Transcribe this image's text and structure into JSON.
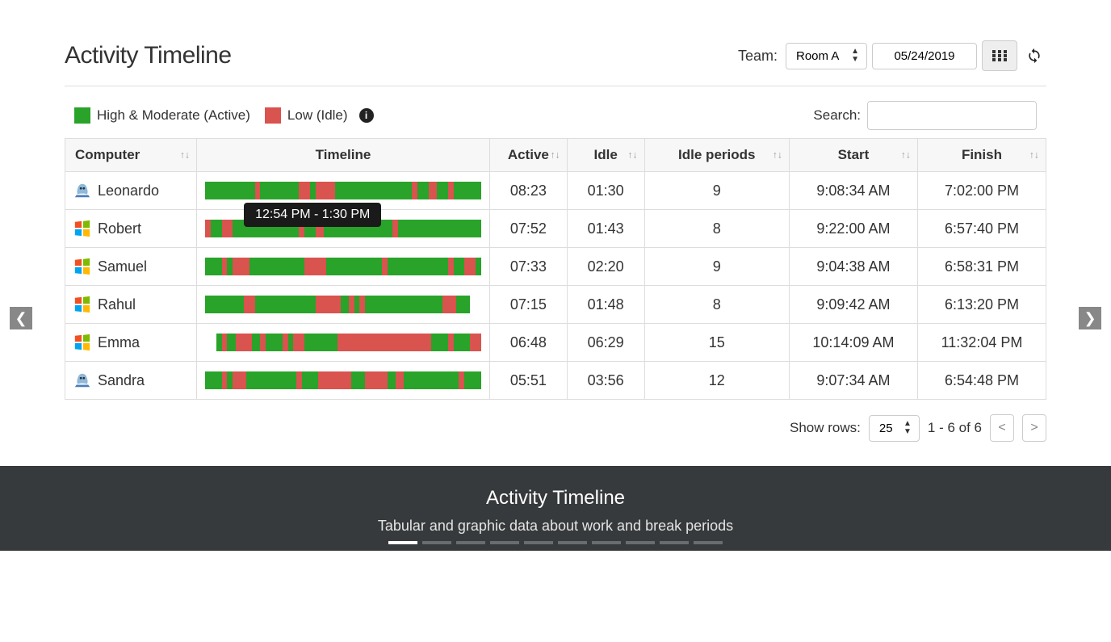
{
  "header": {
    "title": "Activity Timeline",
    "team_label": "Team:",
    "team_value": "Room A",
    "date_value": "05/24/2019"
  },
  "legend": {
    "active_label": "High & Moderate (Active)",
    "idle_label": "Low (Idle)"
  },
  "search": {
    "label": "Search:",
    "value": ""
  },
  "columns": {
    "computer": "Computer",
    "timeline": "Timeline",
    "active": "Active",
    "idle": "Idle",
    "idle_periods": "Idle periods",
    "start": "Start",
    "finish": "Finish"
  },
  "tooltip": "12:54 PM - 1:30 PM",
  "rows": [
    {
      "name": "Leonardo",
      "os": "mac",
      "active": "08:23",
      "idle": "01:30",
      "periods": "9",
      "start": "9:08:34 AM",
      "finish": "7:02:00 PM",
      "segments": [
        [
          "g",
          18
        ],
        [
          "r",
          2
        ],
        [
          "g",
          14
        ],
        [
          "r",
          4
        ],
        [
          "g",
          2
        ],
        [
          "r",
          7
        ],
        [
          "g",
          28
        ],
        [
          "r",
          2
        ],
        [
          "g",
          4
        ],
        [
          "r",
          3
        ],
        [
          "g",
          4
        ],
        [
          "r",
          2
        ],
        [
          "g",
          10
        ]
      ]
    },
    {
      "name": "Robert",
      "os": "win",
      "active": "07:52",
      "idle": "01:43",
      "periods": "8",
      "start": "9:22:00 AM",
      "finish": "6:57:40 PM",
      "segments": [
        [
          "r",
          2
        ],
        [
          "g",
          4
        ],
        [
          "r",
          4
        ],
        [
          "g",
          24
        ],
        [
          "r",
          2
        ],
        [
          "g",
          4
        ],
        [
          "r",
          3
        ],
        [
          "g",
          25
        ],
        [
          "r",
          2
        ],
        [
          "g",
          30
        ]
      ]
    },
    {
      "name": "Samuel",
      "os": "win",
      "active": "07:33",
      "idle": "02:20",
      "periods": "9",
      "start": "9:04:38 AM",
      "finish": "6:58:31 PM",
      "segments": [
        [
          "g",
          6
        ],
        [
          "r",
          2
        ],
        [
          "g",
          2
        ],
        [
          "r",
          6
        ],
        [
          "g",
          20
        ],
        [
          "r",
          8
        ],
        [
          "g",
          20
        ],
        [
          "r",
          2
        ],
        [
          "g",
          22
        ],
        [
          "r",
          2
        ],
        [
          "g",
          4
        ],
        [
          "r",
          4
        ],
        [
          "g",
          2
        ]
      ]
    },
    {
      "name": "Rahul",
      "os": "win",
      "active": "07:15",
      "idle": "01:48",
      "periods": "8",
      "start": "9:09:42 AM",
      "finish": "6:13:20 PM",
      "segments": [
        [
          "g",
          14
        ],
        [
          "r",
          4
        ],
        [
          "g",
          22
        ],
        [
          "r",
          9
        ],
        [
          "g",
          3
        ],
        [
          "r",
          2
        ],
        [
          "g",
          2
        ],
        [
          "r",
          2
        ],
        [
          "g",
          28
        ],
        [
          "r",
          5
        ],
        [
          "g",
          5
        ],
        [
          "e",
          4
        ]
      ]
    },
    {
      "name": "Emma",
      "os": "win",
      "active": "06:48",
      "idle": "06:29",
      "periods": "15",
      "start": "10:14:09 AM",
      "finish": "11:32:04 PM",
      "segments": [
        [
          "e",
          4
        ],
        [
          "g",
          2
        ],
        [
          "r",
          2
        ],
        [
          "g",
          3
        ],
        [
          "r",
          6
        ],
        [
          "g",
          3
        ],
        [
          "r",
          2
        ],
        [
          "g",
          6
        ],
        [
          "r",
          2
        ],
        [
          "g",
          2
        ],
        [
          "r",
          4
        ],
        [
          "g",
          12
        ],
        [
          "r",
          34
        ],
        [
          "g",
          6
        ],
        [
          "r",
          2
        ],
        [
          "g",
          6
        ],
        [
          "r",
          4
        ]
      ]
    },
    {
      "name": "Sandra",
      "os": "mac",
      "active": "05:51",
      "idle": "03:56",
      "periods": "12",
      "start": "9:07:34 AM",
      "finish": "6:54:48 PM",
      "segments": [
        [
          "g",
          6
        ],
        [
          "r",
          2
        ],
        [
          "g",
          2
        ],
        [
          "r",
          5
        ],
        [
          "g",
          18
        ],
        [
          "r",
          2
        ],
        [
          "g",
          6
        ],
        [
          "r",
          12
        ],
        [
          "g",
          5
        ],
        [
          "r",
          8
        ],
        [
          "g",
          3
        ],
        [
          "r",
          3
        ],
        [
          "g",
          20
        ],
        [
          "r",
          2
        ],
        [
          "g",
          6
        ]
      ]
    }
  ],
  "pager": {
    "show_rows_label": "Show rows:",
    "show_rows_value": "25",
    "range": "1 - 6 of 6"
  },
  "footer": {
    "title": "Activity Timeline",
    "subtitle": "Tabular and graphic data about work and break periods"
  },
  "chart_data": {
    "type": "table",
    "title": "Activity Timeline",
    "note": "Per-user horizontal stacked bar of active (green) vs idle (red) segments over the workday of 05/24/2019. Segment widths are approximate percentages of the day; exact minute boundaries beyond the visible tooltip are not labeled.",
    "legend": {
      "green": "High & Moderate (Active)",
      "red": "Low (Idle)"
    },
    "tooltip_visible": "12:54 PM - 1:30 PM",
    "columns": [
      "Computer",
      "Active",
      "Idle",
      "Idle periods",
      "Start",
      "Finish"
    ],
    "rows": [
      [
        "Leonardo",
        "08:23",
        "01:30",
        9,
        "9:08:34 AM",
        "7:02:00 PM"
      ],
      [
        "Robert",
        "07:52",
        "01:43",
        8,
        "9:22:00 AM",
        "6:57:40 PM"
      ],
      [
        "Samuel",
        "07:33",
        "02:20",
        9,
        "9:04:38 AM",
        "6:58:31 PM"
      ],
      [
        "Rahul",
        "07:15",
        "01:48",
        8,
        "9:09:42 AM",
        "6:13:20 PM"
      ],
      [
        "Emma",
        "06:48",
        "06:29",
        15,
        "10:14:09 AM",
        "11:32:04 PM"
      ],
      [
        "Sandra",
        "05:51",
        "03:56",
        12,
        "9:07:34 AM",
        "6:54:48 PM"
      ]
    ]
  }
}
